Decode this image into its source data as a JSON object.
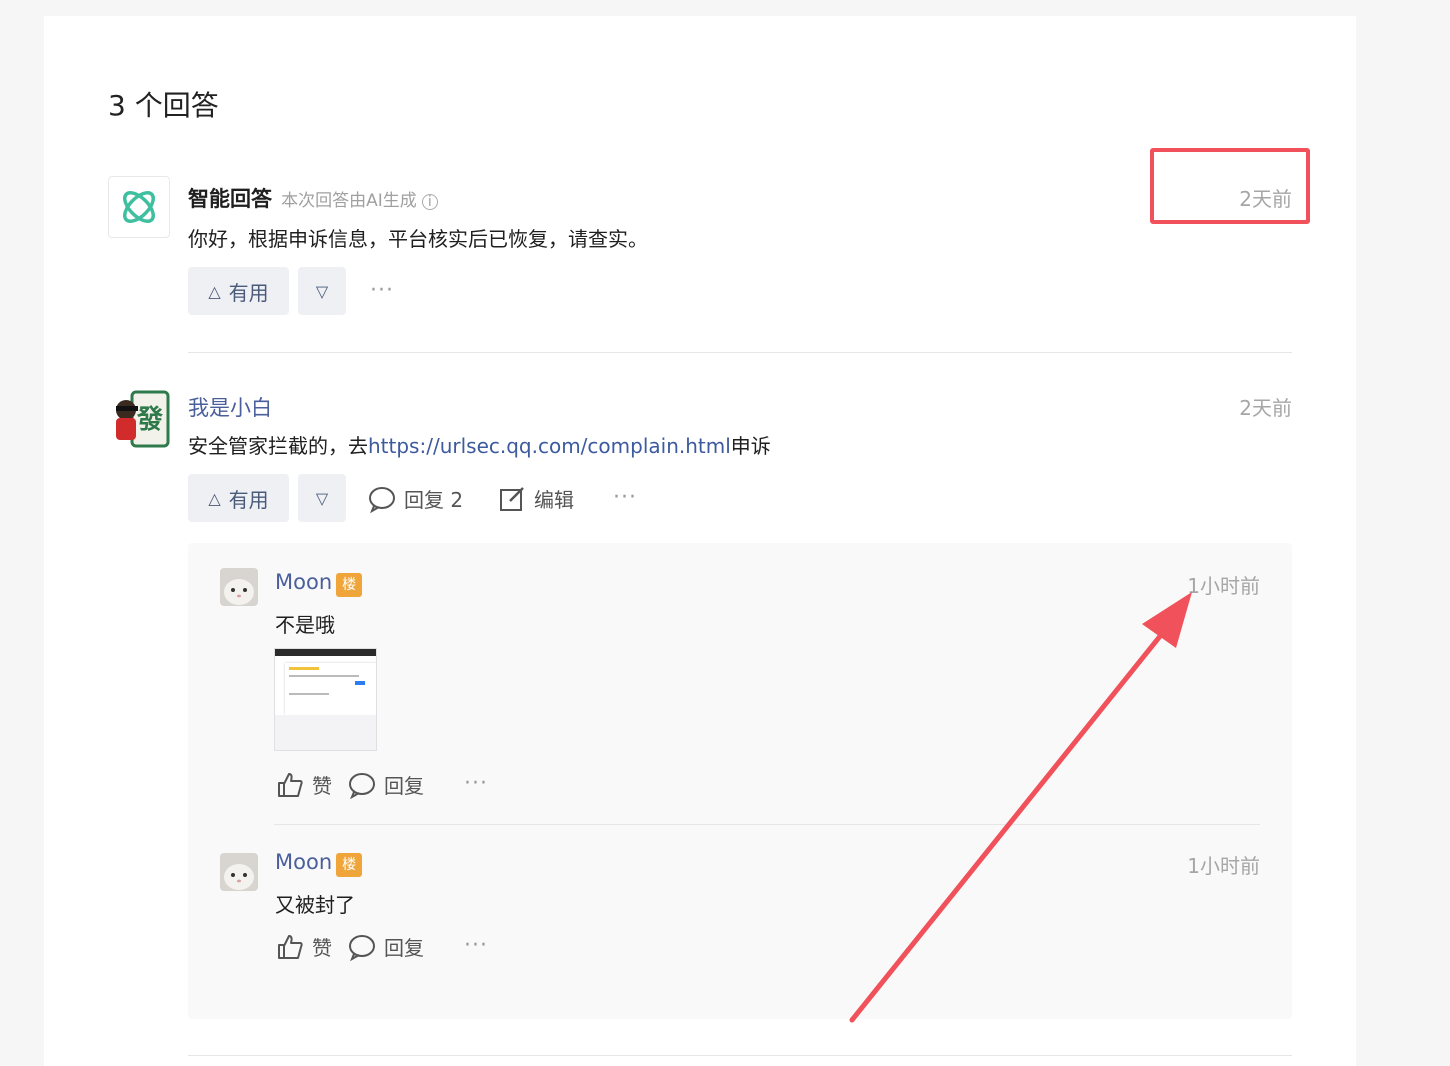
{
  "header": {
    "answer_count": "3 个回答"
  },
  "answers": [
    {
      "name": "智能回答",
      "subtitle": "本次回答由AI生成",
      "time": "2天前",
      "content": "你好，根据申诉信息，平台核实后已恢复，请查实。",
      "useful_label": "有用"
    },
    {
      "name": "我是小白",
      "time": "2天前",
      "content_prefix": "安全管家拦截的，去",
      "content_link": "https://urlsec.qq.com/complain.html",
      "content_suffix": "申诉",
      "useful_label": "有用",
      "reply_label": "回复 2",
      "edit_label": "编辑"
    }
  ],
  "replies": [
    {
      "name": "Moon",
      "badge": "楼",
      "time": "1小时前",
      "content": "不是哦",
      "like_label": "赞",
      "reply_label": "回复"
    },
    {
      "name": "Moon",
      "badge": "楼",
      "time": "1小时前",
      "content": "又被封了",
      "like_label": "赞",
      "reply_label": "回复"
    }
  ],
  "more_glyph": "···",
  "colors": {
    "highlight": "#f0515a",
    "link": "#3d5a9e",
    "badge": "#f0a53a",
    "ai_icon": "#3fbfa0"
  }
}
